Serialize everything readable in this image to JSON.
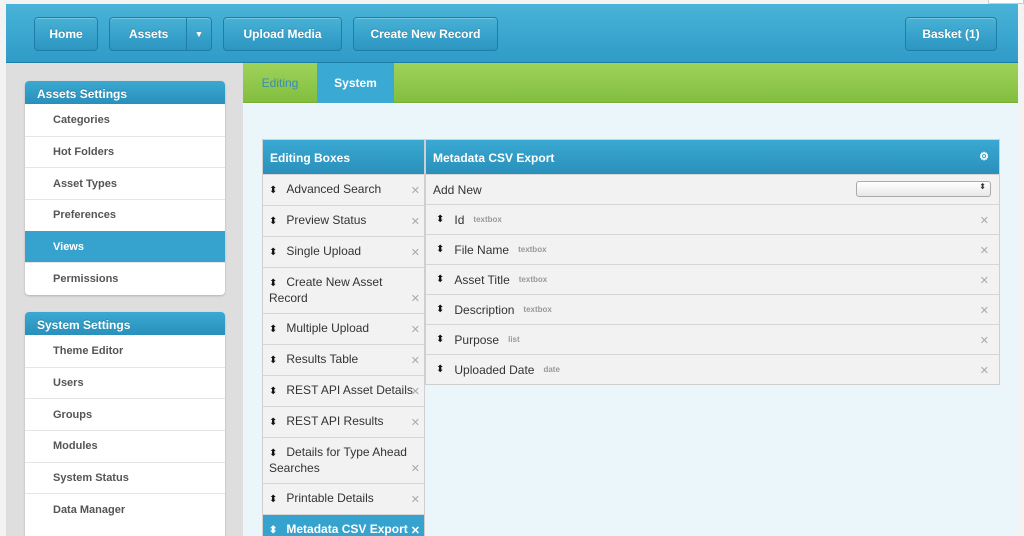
{
  "topbar": {
    "home_label": "Home",
    "assets_label": "Assets",
    "upload_label": "Upload Media",
    "create_label": "Create New Record",
    "basket_label": "Basket (1)"
  },
  "sidebar": {
    "assets_settings": {
      "title": "Assets Settings",
      "items": [
        "Categories",
        "Hot Folders",
        "Asset Types",
        "Preferences",
        "Views",
        "Permissions"
      ],
      "active": "Views"
    },
    "system_settings": {
      "title": "System Settings",
      "items": [
        "Theme Editor",
        "Users",
        "Groups",
        "Modules",
        "System Status",
        "Data Manager"
      ]
    }
  },
  "tabs": {
    "editing": "Editing",
    "system": "System",
    "active": "System"
  },
  "editing_boxes": {
    "title": "Editing Boxes",
    "items": [
      "Advanced Search",
      "Preview Status",
      "Single Upload",
      "Create New Asset Record",
      "Multiple Upload",
      "Results Table",
      "REST API Asset Details",
      "REST API Results",
      "Details for Type Ahead Searches",
      "Printable Details",
      "Metadata CSV Export"
    ],
    "selected": "Metadata CSV Export"
  },
  "metadata_export": {
    "title": "Metadata CSV Export",
    "add_new_label": "Add New",
    "add_new_value": "",
    "fields": [
      {
        "name": "Id",
        "type": "textbox"
      },
      {
        "name": "File Name",
        "type": "textbox"
      },
      {
        "name": "Asset Title",
        "type": "textbox"
      },
      {
        "name": "Description",
        "type": "textbox"
      },
      {
        "name": "Purpose",
        "type": "list"
      },
      {
        "name": "Uploaded Date",
        "type": "date"
      }
    ]
  },
  "icons": {
    "drag": "drag-handle-icon",
    "remove": "close-icon",
    "gear": "gear-icon",
    "dropdown": "chevron-down-icon"
  },
  "colors": {
    "primary_blue": "#36a3cf",
    "tab_green": "#8fc74a"
  }
}
